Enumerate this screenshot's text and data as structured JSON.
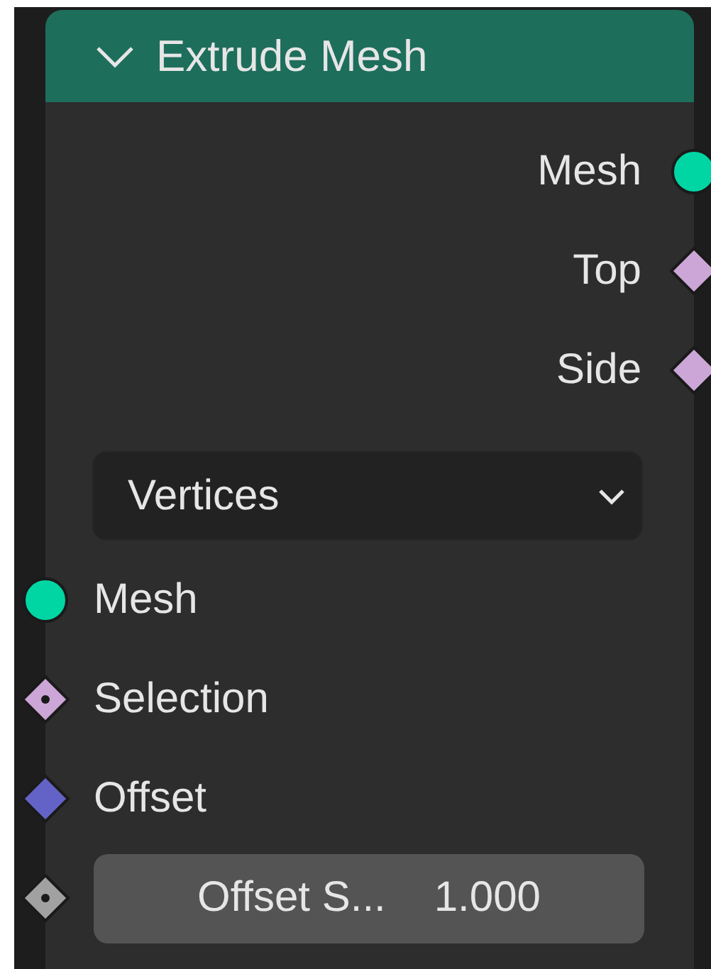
{
  "node": {
    "title": "Extrude Mesh",
    "expanded": true,
    "outputs": [
      {
        "label": "Mesh",
        "kind": "circle",
        "color": "#00d6a3"
      },
      {
        "label": "Top",
        "kind": "diamond",
        "color": "#cca6d6"
      },
      {
        "label": "Side",
        "kind": "diamond",
        "color": "#cca6d6"
      }
    ],
    "dropdown": {
      "value": "Vertices"
    },
    "inputs": [
      {
        "label": "Mesh",
        "kind": "circle",
        "color": "#00d6a3"
      },
      {
        "label": "Selection",
        "kind": "diamond_dot",
        "color": "#cca6d6"
      },
      {
        "label": "Offset",
        "kind": "diamond",
        "color": "#6363c7"
      },
      {
        "label": "Offset S...",
        "value": "1.000",
        "kind": "diamond_dot",
        "color": "#a1a1a1"
      }
    ]
  }
}
